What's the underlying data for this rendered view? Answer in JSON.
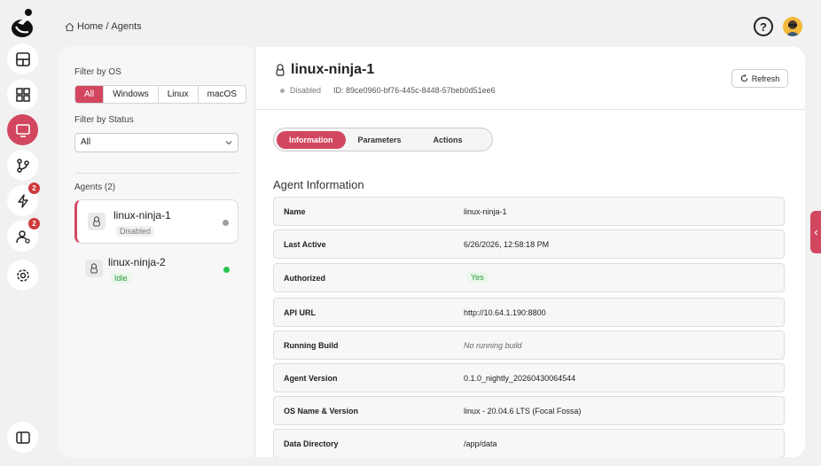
{
  "breadcrumb": {
    "home": "Home",
    "separator": "/",
    "current": "Agents"
  },
  "header": {
    "help_label": "?"
  },
  "rail": {
    "items": [
      {
        "icon": "dashboard-icon"
      },
      {
        "icon": "widgets-icon"
      },
      {
        "icon": "monitor-icon",
        "active": true
      },
      {
        "icon": "git-branch-icon"
      },
      {
        "icon": "lightning-icon",
        "badge": "2"
      },
      {
        "icon": "user-settings-icon",
        "badge": "2"
      },
      {
        "icon": "gear-icon"
      },
      {
        "icon": "sidebar-toggle-icon"
      }
    ]
  },
  "filters": {
    "os_label": "Filter by OS",
    "os_options": [
      "All",
      "Windows",
      "Linux",
      "macOS"
    ],
    "os_selected": "All",
    "status_label": "Filter by Status",
    "status_value": "All"
  },
  "agents": {
    "heading": "Agents (2)",
    "list": [
      {
        "name": "linux-ninja-1",
        "status": "Disabled",
        "dot_color": "#9e9e9e"
      },
      {
        "name": "linux-ninja-2",
        "status": "Idle",
        "dot_color": "#2bc24b"
      }
    ]
  },
  "detail": {
    "title": "linux-ninja-1",
    "status": "Disabled",
    "id_text": "ID: 89ce0960-bf76-445c-8448-57beb0d51ee6",
    "refresh_label": "Refresh",
    "tabs": [
      "Information",
      "Parameters",
      "Actions"
    ],
    "section_title": "Agent Information",
    "rows": [
      {
        "key": "Name",
        "value": "linux-ninja-1"
      },
      {
        "key": "Last Active",
        "value": "6/26/2026, 12:58:18 PM"
      },
      {
        "key": "Authorized",
        "value": "Yes"
      },
      {
        "key": "API URL",
        "value": "http://10.64.1.190:8800"
      },
      {
        "key": "Running Build",
        "value": "No running build"
      },
      {
        "key": "Agent Version",
        "value": "0.1.0_nightly_20260430064544"
      },
      {
        "key": "OS Name & Version",
        "value": "linux - 20.04.6 LTS (Focal Fossa)"
      },
      {
        "key": "Data Directory",
        "value": "/app/data"
      }
    ]
  },
  "colors": {
    "accent": "#d2475f",
    "success": "#2a9a3a"
  }
}
